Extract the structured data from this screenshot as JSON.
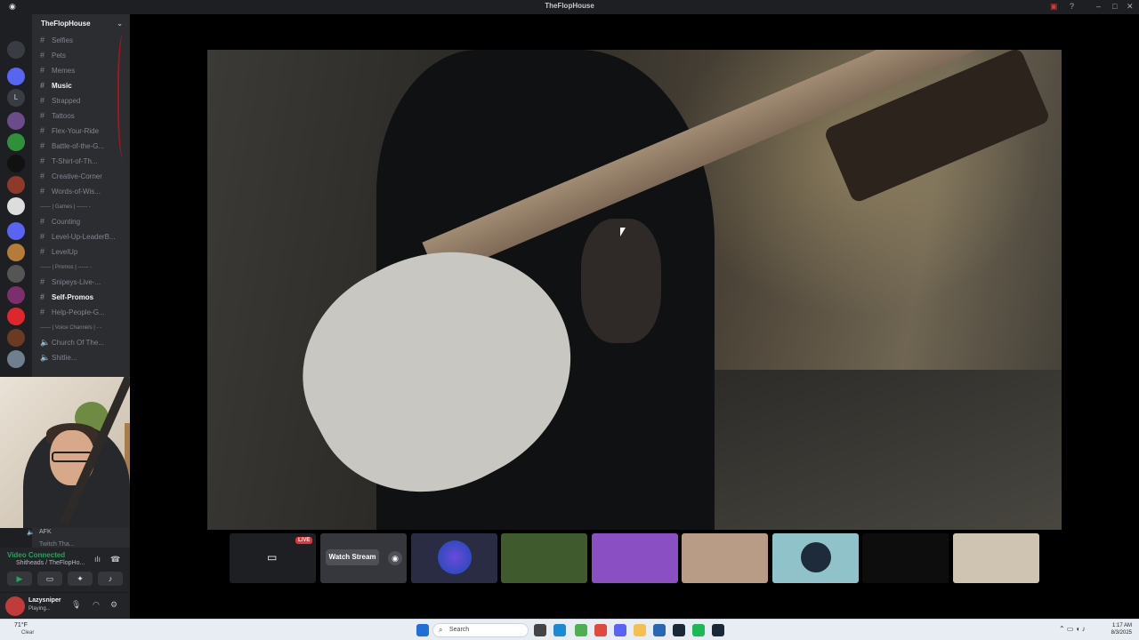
{
  "window": {
    "title": "TheFlopHouse"
  },
  "server": {
    "name": "TheFlopHouse",
    "channels": [
      {
        "label": "Selfies",
        "icon": "lipstick-emoji",
        "bright": false
      },
      {
        "label": "Pets",
        "icon": "pet-emoji",
        "bright": false
      },
      {
        "label": "Memes",
        "icon": "laugh-emoji",
        "bright": false
      },
      {
        "label": "Music",
        "icon": "headphones-emoji",
        "bright": true
      },
      {
        "label": "Strapped",
        "icon": "gun-emoji",
        "bright": false
      },
      {
        "label": "Tattoos",
        "icon": "syringe-emoji",
        "bright": false
      },
      {
        "label": "Flex-Your-Ride",
        "icon": "car-emoji",
        "bright": false
      },
      {
        "label": "Battle-of-the-G...",
        "icon": "swords-emoji",
        "bright": false
      },
      {
        "label": "T-Shirt-of-Th...",
        "icon": "shirt-emoji",
        "bright": false
      },
      {
        "label": "Creative-Corner",
        "icon": "brush-emoji",
        "bright": false
      },
      {
        "label": "Words-of-Wis...",
        "icon": "brain-emoji",
        "bright": false
      }
    ],
    "cat_games": "------ | Games | ------ -",
    "games": [
      {
        "label": "Counting",
        "icon": "numbers-emoji"
      },
      {
        "label": "Level-Up-LeaderB...",
        "icon": ""
      },
      {
        "label": "LevelUp",
        "icon": ""
      }
    ],
    "cat_promos": "------ | Promos | ------ -",
    "promos": [
      {
        "label": "Snipeys-Live-...",
        "icon": "red-circle-emoji",
        "bright": false
      },
      {
        "label": "Self-Promos",
        "icon": "megaphone-emoji",
        "bright": true
      },
      {
        "label": "Help-People-G...",
        "icon": "hand-emoji",
        "bright": false
      }
    ],
    "cat_voice": "------ | Voice Channels | - -",
    "voice": [
      {
        "label": "Church Of The..."
      },
      {
        "label": "Shitlie..."
      }
    ],
    "afk_label": "AFK",
    "afk_below": "Twitch Tha..."
  },
  "voice_status": {
    "connected": "Video Connected",
    "channel": "Shitheads / TheFlopHo..."
  },
  "user": {
    "name": "Lazysniper",
    "status": "Playing..."
  },
  "stream": {
    "live_badge": "LIVE",
    "watch_label": "Watch Stream"
  },
  "taskbar": {
    "weather_temp": "71°F",
    "weather_desc": "Clear",
    "search_placeholder": "Search",
    "time": "1:17 AM",
    "date": "8/3/2025"
  },
  "colors": {
    "discord_bg": "#2b2d31",
    "guild_bg": "#1e1f22",
    "live_red": "#da373c",
    "connected_green": "#23a55a"
  }
}
